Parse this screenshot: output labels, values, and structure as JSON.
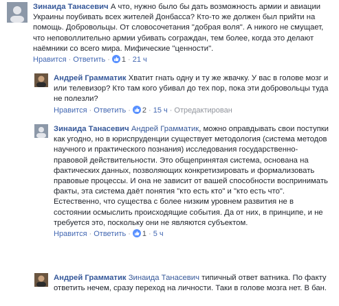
{
  "colors": {
    "link": "#365899",
    "action": "#4267b2",
    "meta": "#90949c",
    "like": "#5890ff"
  },
  "comments": [
    {
      "author": "Зинаида Танасевич",
      "reply_to": "",
      "text": "А что, нужно было бы дать возможность армии и авиации Украины поубивать всех жителей Донбасса? Кто-то же должен был прийти на помощь. Добровольцы. От словосочетания \"добрая воля\". А никого не смущает, что неповоллительно армии убивать сограждан, тем более, когда это делают наёмники со всего мира. Мифические \"ценности\".",
      "like_label": "Нравится",
      "reply_label": "Ответить",
      "likes": "1",
      "time": "21 ч",
      "extra": "",
      "avatar_icon": "user-avatar"
    },
    {
      "author": "Андрей Грамматик",
      "reply_to": "",
      "text": "Хватит гнать одну и ту же жвачку. У вас в голове мозг и или телевизор? Кто там кого убивал до тех пор, пока эти добровольцы туда не полезли?",
      "like_label": "Нравится",
      "reply_label": "Ответить",
      "likes": "2",
      "time": "15 ч",
      "extra": "Отредактирован",
      "avatar_icon": "user-avatar"
    },
    {
      "author": "Зинаида Танасевич",
      "reply_to": "Андрей Грамматик",
      "text": ", можно оправдывать свои поступки как угодно, но в юриспруденции существует методология (система методов научного и практического познания) исследования государственно-правовой действительности. Это общепринятая система, основана на фактических данных, позволяющих конкретизировать и формализовать правовые процессы. И она не зависит от вашей способности воспринимать факты, эта система даёт понятия \"кто есть кто\" и \"кто есть что\". Естественно, что существа с более низким уровнем развития не в состоянии осмыслить происходящие события. Да от них, в принципе, и не требуется это, поскольку они не являются субъектом.",
      "like_label": "Нравится",
      "reply_label": "Ответить",
      "likes": "1",
      "time": "5 ч",
      "extra": "",
      "avatar_icon": "user-avatar"
    },
    {
      "author": "Андрей Грамматик",
      "reply_to": "Зинаида Танасевич",
      "text": "типичный ответ ватника. По факту ответить нечем, сразу переход на личности. Таки в голове мозга нет. В бан.",
      "like_label": "",
      "reply_label": "",
      "likes": "",
      "time": "",
      "extra": "",
      "avatar_icon": "user-avatar"
    }
  ]
}
